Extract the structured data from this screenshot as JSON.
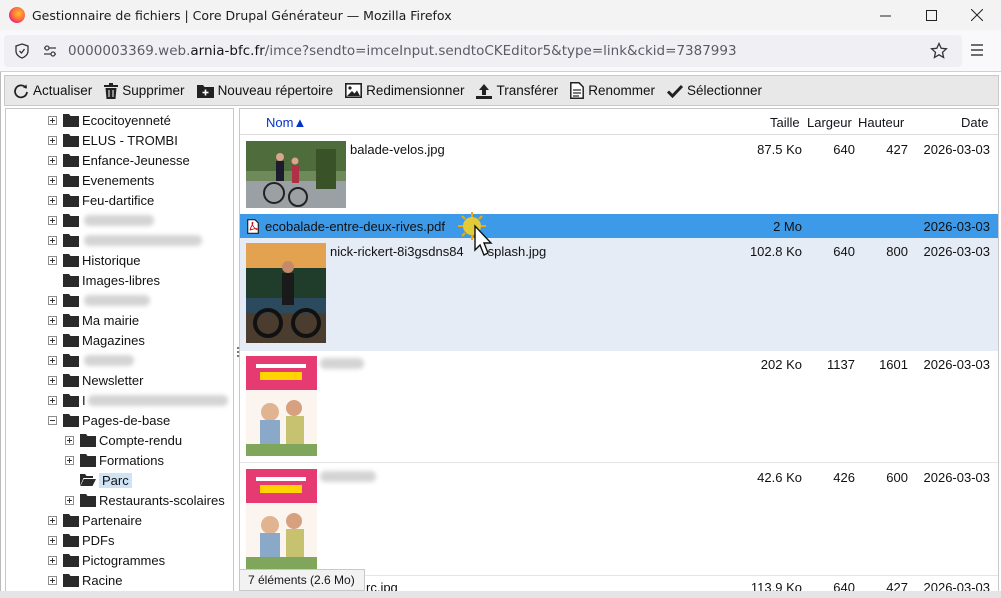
{
  "window": {
    "title": "Gestionnaire de fichiers | Core Drupal Générateur — Mozilla Firefox",
    "url_prefix": "0000003369.web.",
    "url_domain": "arnia-bfc.fr",
    "url_path": "/imce?sendto=imceInput.sendtoCKEditor5&type=link&ckid=7387993"
  },
  "toolbar": {
    "refresh": "Actualiser",
    "delete": "Supprimer",
    "new_folder": "Nouveau répertoire",
    "resize": "Redimensionner",
    "upload": "Transférer",
    "rename": "Renommer",
    "select": "Sélectionner"
  },
  "tree": {
    "items": [
      {
        "label": "Ecocitoyenneté",
        "expander": "plus"
      },
      {
        "label": "ELUS - TROMBI",
        "expander": "plus"
      },
      {
        "label": "Enfance-Jeunesse",
        "expander": "plus"
      },
      {
        "label": "Evenements",
        "expander": "plus"
      },
      {
        "label": "Feu-dartifice",
        "expander": "plus"
      },
      {
        "label": "",
        "expander": "plus",
        "blurred": true
      },
      {
        "label": "",
        "expander": "plus",
        "blurred": true
      },
      {
        "label": "Historique",
        "expander": "plus"
      },
      {
        "label": "Images-libres",
        "expander": "none"
      },
      {
        "label": "",
        "expander": "plus",
        "blurred": true
      },
      {
        "label": "Ma mairie",
        "expander": "plus"
      },
      {
        "label": "Magazines",
        "expander": "plus"
      },
      {
        "label": "",
        "expander": "plus",
        "blurred": true
      },
      {
        "label": "Newsletter",
        "expander": "plus"
      },
      {
        "label": "I",
        "expander": "plus",
        "blurred": true
      },
      {
        "label": "Pages-de-base",
        "expander": "minus"
      },
      {
        "label": "Compte-rendu",
        "expander": "plus"
      },
      {
        "label": "Formations",
        "expander": "plus"
      },
      {
        "label": "Parc",
        "expander": "none",
        "selected": true
      },
      {
        "label": "Restaurants-scolaires",
        "expander": "plus"
      },
      {
        "label": "Partenaire",
        "expander": "plus"
      },
      {
        "label": "PDFs",
        "expander": "plus"
      },
      {
        "label": "Pictogrammes",
        "expander": "plus"
      },
      {
        "label": "Racine",
        "expander": "plus"
      }
    ]
  },
  "columns": {
    "name": "Nom▲",
    "size": "Taille",
    "width": "Largeur",
    "height": "Hauteur",
    "date": "Date"
  },
  "files": [
    {
      "name": "balade-velos.jpg",
      "size": "87.5 Ko",
      "width": "640",
      "height": "427",
      "date": "2026-03-03"
    },
    {
      "name": "ecobalade-entre-deux-rives.pdf",
      "size": "2 Mo",
      "width": "",
      "height": "",
      "date": "2026-03-03"
    },
    {
      "name": "nick-rickert-8i3gsdns84",
      "name_tail": "splash.jpg",
      "size": "102.8 Ko",
      "width": "640",
      "height": "800",
      "date": "2026-03-03"
    },
    {
      "name": "",
      "size": "202 Ko",
      "width": "1137",
      "height": "1601",
      "date": "2026-03-03"
    },
    {
      "name": "",
      "size": "42.6 Ko",
      "width": "426",
      "height": "600",
      "date": "2026-03-03"
    },
    {
      "name": "",
      "name_tail": "rc.jpg",
      "size": "113.9 Ko",
      "width": "640",
      "height": "427",
      "date": "2026-03-03"
    }
  ],
  "status": {
    "summary": "7 éléments (2.6 Mo)"
  },
  "colors": {
    "selection": "#3d9ae8",
    "highlight_row": "#e6ecf5",
    "link": "#0033cc"
  }
}
